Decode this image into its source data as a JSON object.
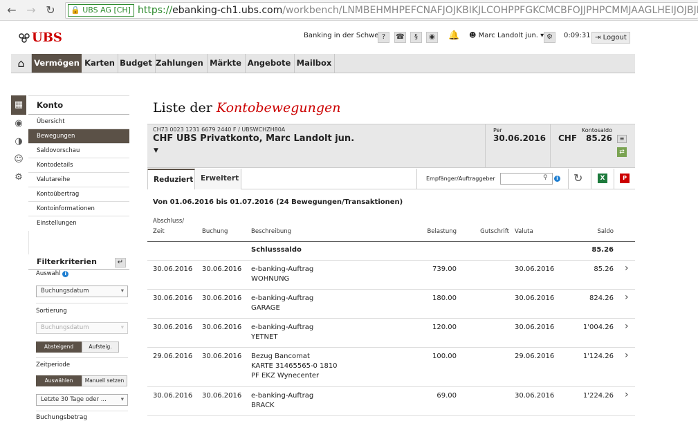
{
  "browser": {
    "ev_label": "UBS AG [CH]",
    "url_scheme": "https://",
    "url_host": "ebanking-ch1.ubs.com",
    "url_path": "/workbench/LNMBEHMHPEFCNAFJOJKBIKJLCOHPPFGKCMCBFOJJPHPCMMJAAGLHEIJOJBJIGDLNHK"
  },
  "header": {
    "logo": "UBS",
    "region": "Banking in der Schweiz",
    "help": "?",
    "section": "§",
    "user": "Marc Landolt jun.",
    "timer": "0:09:31",
    "logout": "Logout"
  },
  "nav": [
    "Vermögen",
    "Karten",
    "Budget",
    "Zahlungen",
    "Märkte",
    "Angebote",
    "Mailbox"
  ],
  "sidebar": {
    "head": "Konto",
    "items": [
      "Übersicht",
      "Bewegungen",
      "Saldovorschau",
      "Kontodetails",
      "Valutareihe",
      "Kontoübertrag",
      "Kontoinformationen",
      "Einstellungen"
    ]
  },
  "filter": {
    "title": "Filterkriterien",
    "auswahl_label": "Auswahl",
    "auswahl_value": "Buchungsdatum",
    "sort_label": "Sortierung",
    "sort_value": "Buchungsdatum",
    "desc": "Absteigend",
    "asc": "Aufsteig.",
    "period_label": "Zeitperiode",
    "choose": "Auswählen",
    "manual": "Manuell setzen",
    "period_value": "Letzte 30 Tage oder ...",
    "amount_label": "Buchungsbetrag"
  },
  "page": {
    "title_plain": "Liste der",
    "title_em": "Kontobewegungen"
  },
  "account": {
    "iban": "CH73 0023 1231 6679 2440 F / UBSWCHZH80A",
    "name": "CHF UBS Privatkonto, Marc Landolt jun.",
    "per_label": "Per",
    "per_date": "30.06.2016",
    "saldo_label": "Kontosaldo",
    "currency": "CHF",
    "saldo": "85.26"
  },
  "tabs": {
    "reduced": "Reduziert",
    "extended": "Erweitert",
    "search_label": "Empfänger/Auftraggeber"
  },
  "summary": "Von 01.06.2016 bis 01.07.2016 (24 Bewegungen/Transaktionen)",
  "columns": {
    "abschluss": "Abschluss/",
    "zeit": "Zeit",
    "buchung": "Buchung",
    "beschreibung": "Beschreibung",
    "belastung": "Belastung",
    "gutschrift": "Gutschrift",
    "valuta": "Valuta",
    "saldo": "Saldo"
  },
  "closing": {
    "label": "Schlusssaldo",
    "value": "85.26"
  },
  "rows": [
    {
      "zeit": "30.06.2016",
      "buchung": "30.06.2016",
      "desc": [
        "e-banking-Auftrag",
        "WOHNUNG"
      ],
      "belastung": "739.00",
      "valuta": "30.06.2016",
      "saldo": "85.26"
    },
    {
      "zeit": "30.06.2016",
      "buchung": "30.06.2016",
      "desc": [
        "e-banking-Auftrag",
        "GARAGE"
      ],
      "belastung": "180.00",
      "valuta": "30.06.2016",
      "saldo": "824.26"
    },
    {
      "zeit": "30.06.2016",
      "buchung": "30.06.2016",
      "desc": [
        "e-banking-Auftrag",
        "YETNET"
      ],
      "belastung": "120.00",
      "valuta": "30.06.2016",
      "saldo": "1'004.26"
    },
    {
      "zeit": "29.06.2016",
      "buchung": "30.06.2016",
      "desc": [
        "Bezug Bancomat",
        "KARTE 31465565-0 1810",
        "PF EKZ Wynecenter"
      ],
      "belastung": "100.00",
      "valuta": "29.06.2016",
      "saldo": "1'124.26"
    },
    {
      "zeit": "30.06.2016",
      "buchung": "30.06.2016",
      "desc": [
        "e-banking-Auftrag",
        "BRACK"
      ],
      "belastung": "69.00",
      "valuta": "30.06.2016",
      "saldo": "1'224.26"
    }
  ],
  "colors": {
    "accent": "#c00000",
    "active_nav": "#5b5147",
    "secure": "#2c8a2c"
  }
}
